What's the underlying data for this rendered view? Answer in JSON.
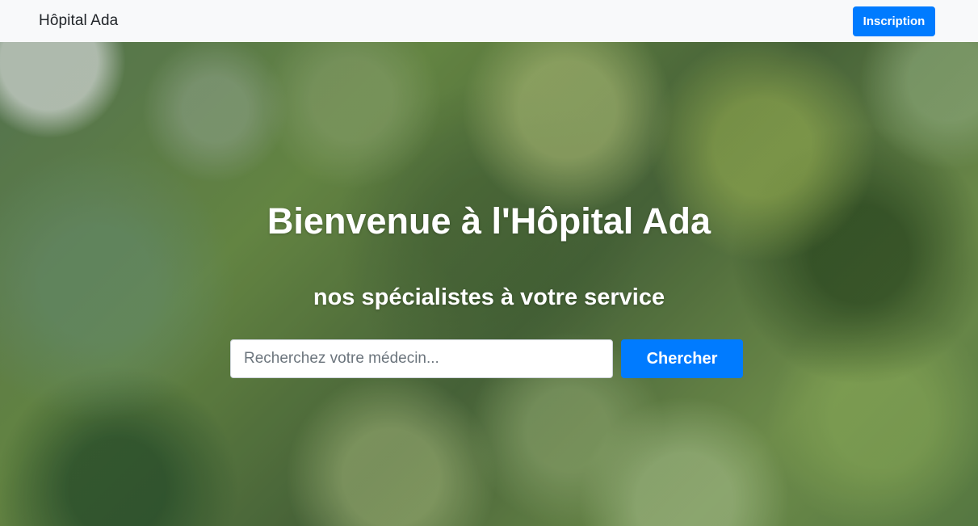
{
  "navbar": {
    "brand": "Hôpital Ada",
    "signup_label": "Inscription"
  },
  "hero": {
    "title": "Bienvenue à l'Hôpital Ada",
    "subtitle": "nos spécialistes à votre service",
    "search": {
      "placeholder": "Recherchez votre médecin...",
      "value": "",
      "button_label": "Chercher"
    }
  },
  "colors": {
    "primary": "#007bff",
    "navbar_bg": "#f8f9fa",
    "text_dark": "#212529",
    "text_light": "#ffffff"
  }
}
